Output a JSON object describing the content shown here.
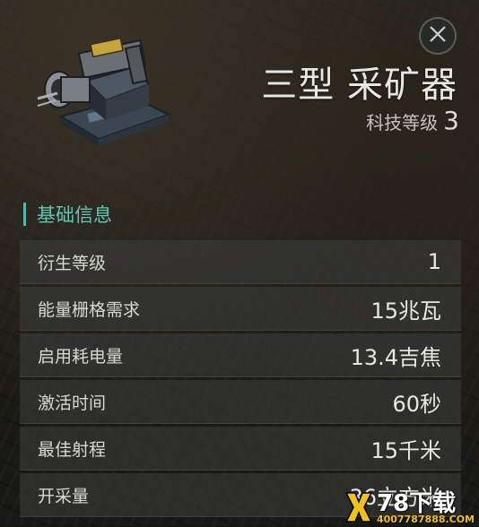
{
  "item": {
    "name": "三型 采矿器",
    "tech_label": "科技等级",
    "tech_level": "3"
  },
  "section": {
    "title": "基础信息"
  },
  "stats": [
    {
      "label": "衍生等级",
      "value": "1"
    },
    {
      "label": "能量栅格需求",
      "value": "15兆瓦"
    },
    {
      "label": "启用耗电量",
      "value": "13.4吉焦"
    },
    {
      "label": "激活时间",
      "value": "60秒"
    },
    {
      "label": "最佳射程",
      "value": "15千米"
    },
    {
      "label": "开采量",
      "value": "36立方米"
    }
  ],
  "watermark": {
    "main": "78下载",
    "sub": "4007787888.COM"
  },
  "icons": {
    "close": "close-icon",
    "item": "mining-laser-module-icon",
    "logo": "watermark-logo-icon"
  },
  "colors": {
    "accent": "#5ec7b9",
    "text": "#e6e6e2",
    "row_bg": "#3a3c3a"
  }
}
